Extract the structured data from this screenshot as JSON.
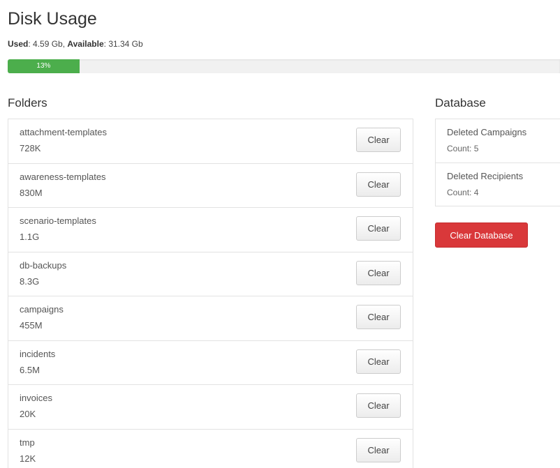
{
  "page": {
    "title": "Disk Usage"
  },
  "usage": {
    "used_label": "Used",
    "used_value": "4.59 Gb",
    "available_label": "Available",
    "available_value": "31.34 Gb",
    "progress_percent": 13,
    "progress_text": "13%",
    "progress_color": "#4cae4c"
  },
  "folders": {
    "heading": "Folders",
    "clear_label": "Clear",
    "items": [
      {
        "name": "attachment-templates",
        "size": "728K"
      },
      {
        "name": "awareness-templates",
        "size": "830M"
      },
      {
        "name": "scenario-templates",
        "size": "1.1G"
      },
      {
        "name": "db-backups",
        "size": "8.3G"
      },
      {
        "name": "campaigns",
        "size": "455M"
      },
      {
        "name": "incidents",
        "size": "6.5M"
      },
      {
        "name": "invoices",
        "size": "20K"
      },
      {
        "name": "tmp",
        "size": "12K"
      }
    ]
  },
  "database": {
    "heading": "Database",
    "items": [
      {
        "name": "Deleted Campaigns",
        "count": "Count: 5"
      },
      {
        "name": "Deleted Recipients",
        "count": "Count: 4"
      }
    ],
    "clear_button_label": "Clear Database",
    "clear_button_color": "#d9383a"
  }
}
